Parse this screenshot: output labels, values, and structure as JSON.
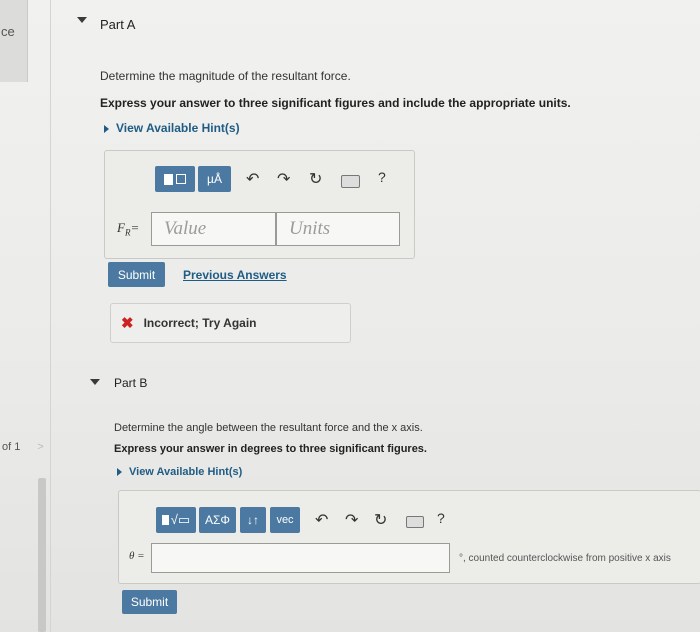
{
  "sidebar": {
    "cut_label": "ce",
    "page_nav": "of 1",
    "next_icon": "chevron-right-icon"
  },
  "partA": {
    "title": "Part A",
    "question": "Determine the magnitude of the resultant force.",
    "instruction": "Express your answer to three significant figures and include the appropriate units.",
    "hint_label": "View Available Hint(s)",
    "toolbar": {
      "mu_label": "µÅ",
      "help_label": "?"
    },
    "answer_label": "F",
    "answer_sub": "R",
    "answer_eq": "=",
    "value_placeholder": "Value",
    "units_placeholder": "Units",
    "submit_label": "Submit",
    "previous_label": "Previous Answers",
    "feedback": "Incorrect; Try Again"
  },
  "partB": {
    "title": "Part B",
    "question": "Determine the angle between the resultant force and the x axis.",
    "instruction": "Express your answer in degrees to three significant figures.",
    "hint_label": "View Available Hint(s)",
    "toolbar": {
      "greek_label": "ΑΣΦ",
      "arrows_label": "↓↑",
      "vec_label": "vec",
      "help_label": "?"
    },
    "answer_label": "θ =",
    "unit_note": "°, counted counterclockwise from positive x axis",
    "submit_label": "Submit"
  },
  "colors": {
    "button": "#4b79a1",
    "link": "#1f5c85",
    "error": "#cc2222"
  }
}
